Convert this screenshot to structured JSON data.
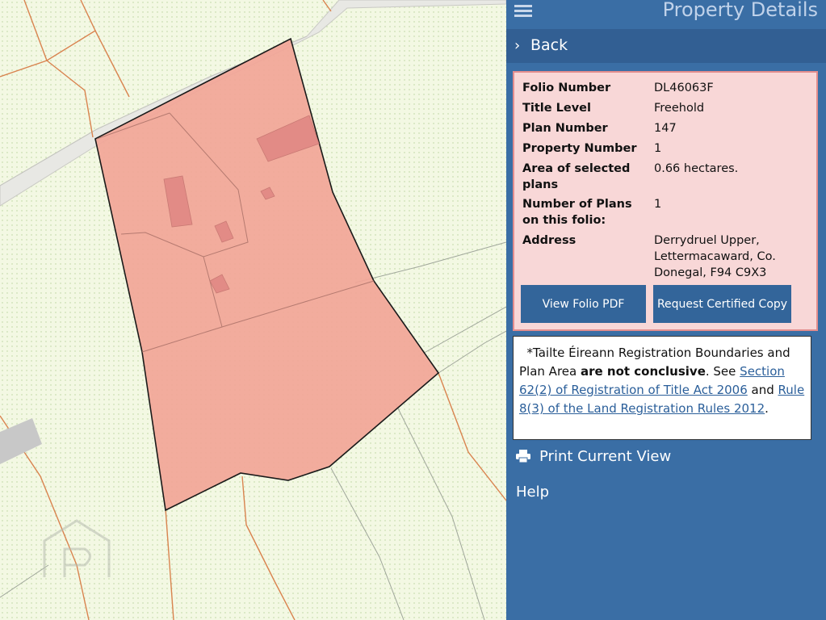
{
  "header": {
    "title": "Property Details",
    "menu_icon": "hamburger-menu-icon"
  },
  "nav": {
    "back_label": "Back",
    "back_icon": "chevron-right-icon"
  },
  "details": [
    {
      "label": "Folio Number",
      "value": "DL46063F"
    },
    {
      "label": "Title Level",
      "value": "Freehold"
    },
    {
      "label": "Plan Number",
      "value": "147"
    },
    {
      "label": "Property Number",
      "value": "1"
    },
    {
      "label": "Area of selected plans",
      "value": "0.66 hectares."
    },
    {
      "label": "Number of Plans on this folio:",
      "value": "1"
    },
    {
      "label": "Address",
      "value": "Derrydruel Upper, Lettermacaward, Co. Donegal, F94 C9X3"
    }
  ],
  "buttons": {
    "view_pdf": "View Folio PDF",
    "request_copy": "Request Certified Copy"
  },
  "notice": {
    "text1": "*Tailte Éireann Registration Boundaries and Plan Area ",
    "bold": "are not conclusive",
    "text2": ". See ",
    "link1": "Section 62(2) of Registration of Title Act 2006",
    "text3": " and ",
    "link2": "Rule 8(3) of the Land Registration Rules 2012",
    "text4": "."
  },
  "actions": {
    "print_label": "Print Current View",
    "print_icon": "printer-icon",
    "help_label": "Help"
  },
  "colors": {
    "panel": "#3a6ea5",
    "parcel_fill": "#f2a597",
    "parcel_stroke": "#1a1a1a",
    "map_bg": "#f3f8e3",
    "boundary": "#d98a5a"
  }
}
